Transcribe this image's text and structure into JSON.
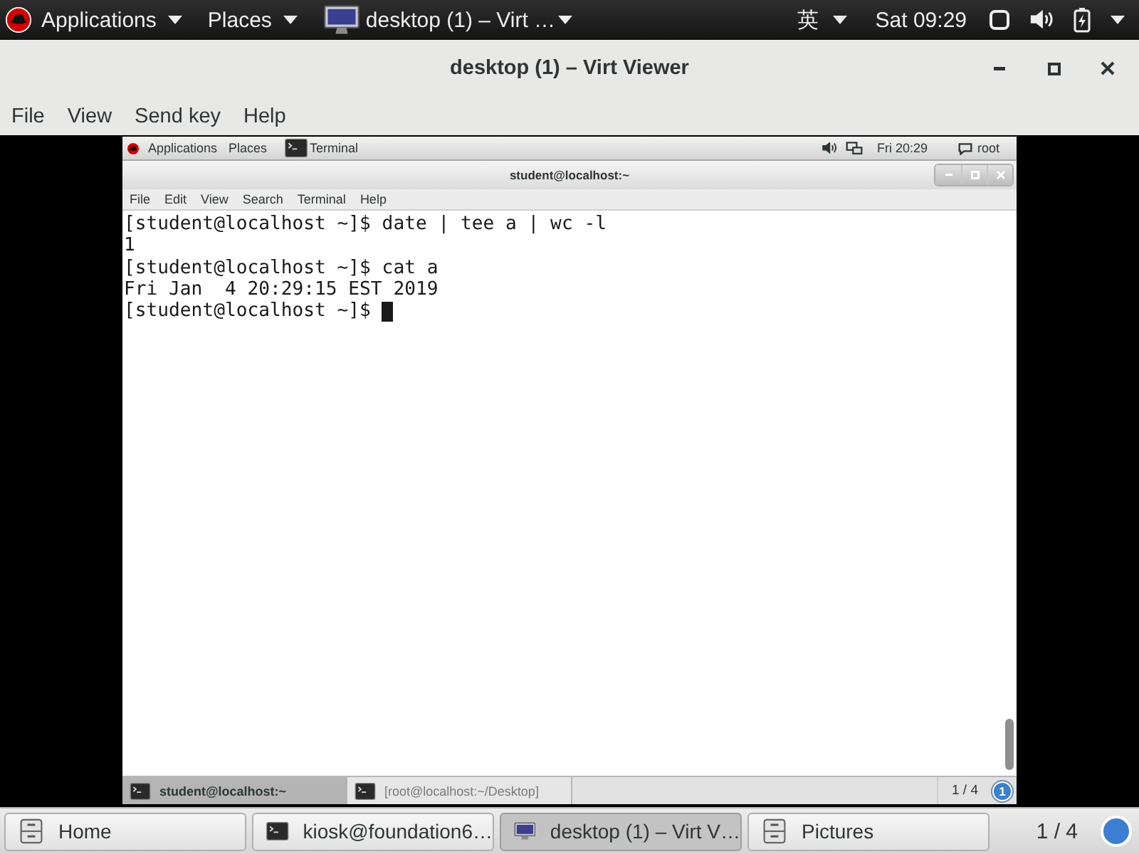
{
  "top_bar": {
    "applications": "Applications",
    "places": "Places",
    "window_item": "desktop (1) – Virt …",
    "input_method": "英",
    "clock": "Sat 09:29"
  },
  "window": {
    "title": "desktop (1) – Virt Viewer"
  },
  "menu": [
    "File",
    "View",
    "Send key",
    "Help"
  ],
  "guest": {
    "top_bar": {
      "applications": "Applications",
      "places": "Places",
      "window_item": "Terminal",
      "clock": "Fri 20:29",
      "user": "root"
    },
    "terminal": {
      "title": "student@localhost:~",
      "menu": [
        "File",
        "Edit",
        "View",
        "Search",
        "Terminal",
        "Help"
      ],
      "lines": [
        "[student@localhost ~]$ date | tee a | wc -l",
        "1",
        "[student@localhost ~]$ cat a",
        "Fri Jan  4 20:29:15 EST 2019",
        "[student@localhost ~]$"
      ],
      "cursor_visible": true
    },
    "window_list": {
      "items": [
        {
          "label": "student@localhost:~",
          "selected": true
        },
        {
          "label": "[root@localhost:~/Desktop]",
          "selected": false
        }
      ],
      "workspace": "1 / 4",
      "notifications": "1"
    }
  },
  "taskbar": {
    "items": [
      {
        "label": "Home",
        "kind": "folder",
        "selected": false
      },
      {
        "label": "kiosk@foundation6…",
        "kind": "terminal",
        "selected": false
      },
      {
        "label": "desktop (1) – Virt V…",
        "kind": "monitor",
        "selected": true
      },
      {
        "label": "Pictures",
        "kind": "folder",
        "selected": false
      }
    ],
    "workspace": "1 / 4"
  }
}
